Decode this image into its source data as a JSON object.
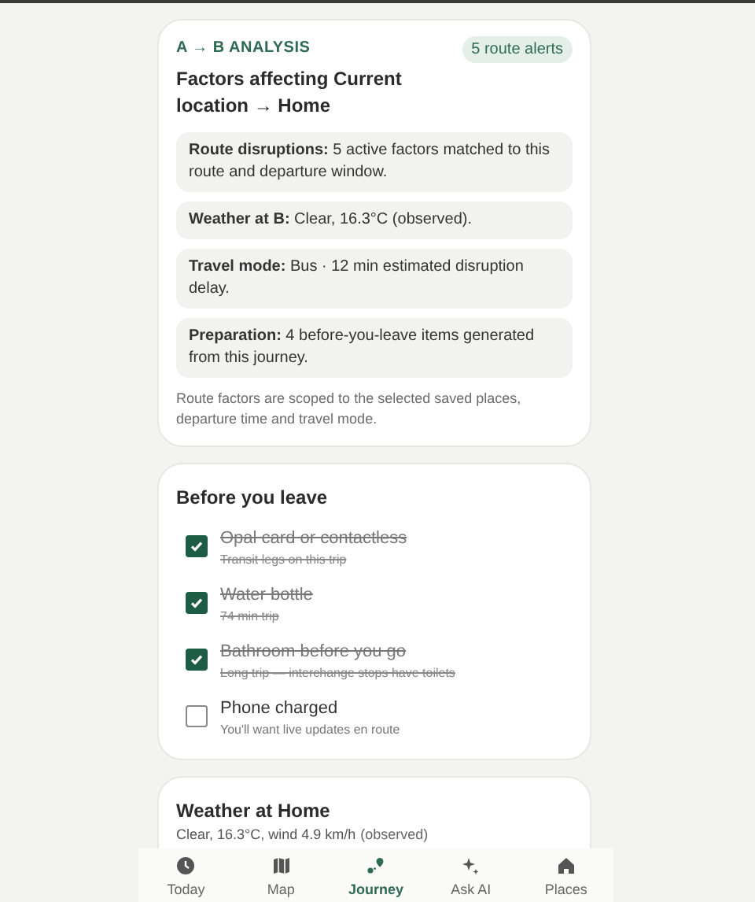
{
  "analysis": {
    "eyebrow": "A → B ANALYSIS",
    "badge": "5 route alerts",
    "title": "Factors affecting Current location → Home",
    "factors": [
      {
        "text": "**Route disruptions:** 5 active factors matched to this route and departure window."
      },
      {
        "text": "**Weather at B:** Clear, 16.3°C (observed)."
      },
      {
        "text": "**Travel mode:** Bus · 12 min estimated disruption delay."
      },
      {
        "text": "**Preparation:** 4 before-you-leave items generated from this journey."
      }
    ],
    "note": "Route factors are scoped to the selected saved places, departure time and travel mode."
  },
  "checklist": {
    "title": "Before you leave",
    "items": [
      {
        "label": "Opal card or contactless",
        "detail": "Transit legs on this trip",
        "checked": true
      },
      {
        "label": "Water bottle",
        "detail": "74 min trip",
        "checked": true
      },
      {
        "label": "Bathroom before you go",
        "detail": "Long trip — interchange stops have toilets",
        "checked": true
      },
      {
        "label": "Phone charged",
        "detail": "You'll want live updates en route",
        "checked": false
      }
    ]
  },
  "weather": {
    "title": "Weather at Home",
    "summary": "Clear, 16.3°C, wind 4.9 km/h",
    "source": "(observed)"
  },
  "nav": [
    {
      "label": "Today",
      "kind": "clock",
      "selected": false
    },
    {
      "label": "Map",
      "kind": "map",
      "selected": false
    },
    {
      "label": "Journey",
      "kind": "route",
      "selected": true
    },
    {
      "label": "Ask AI",
      "kind": "sparkle",
      "selected": false
    },
    {
      "label": "Places",
      "kind": "home",
      "selected": false
    }
  ]
}
